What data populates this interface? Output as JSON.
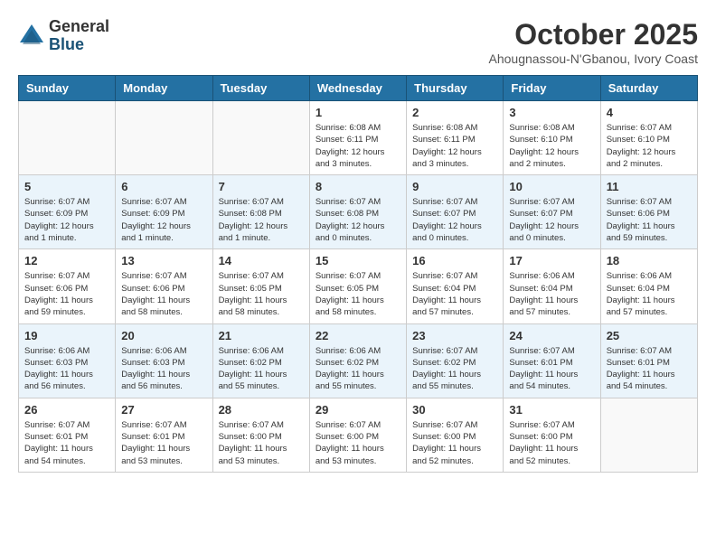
{
  "logo": {
    "general": "General",
    "blue": "Blue"
  },
  "header": {
    "month": "October 2025",
    "location": "Ahougnassou-N'Gbanou, Ivory Coast"
  },
  "weekdays": [
    "Sunday",
    "Monday",
    "Tuesday",
    "Wednesday",
    "Thursday",
    "Friday",
    "Saturday"
  ],
  "weeks": [
    [
      {
        "day": "",
        "info": ""
      },
      {
        "day": "",
        "info": ""
      },
      {
        "day": "",
        "info": ""
      },
      {
        "day": "1",
        "info": "Sunrise: 6:08 AM\nSunset: 6:11 PM\nDaylight: 12 hours and 3 minutes."
      },
      {
        "day": "2",
        "info": "Sunrise: 6:08 AM\nSunset: 6:11 PM\nDaylight: 12 hours and 3 minutes."
      },
      {
        "day": "3",
        "info": "Sunrise: 6:08 AM\nSunset: 6:10 PM\nDaylight: 12 hours and 2 minutes."
      },
      {
        "day": "4",
        "info": "Sunrise: 6:07 AM\nSunset: 6:10 PM\nDaylight: 12 hours and 2 minutes."
      }
    ],
    [
      {
        "day": "5",
        "info": "Sunrise: 6:07 AM\nSunset: 6:09 PM\nDaylight: 12 hours and 1 minute."
      },
      {
        "day": "6",
        "info": "Sunrise: 6:07 AM\nSunset: 6:09 PM\nDaylight: 12 hours and 1 minute."
      },
      {
        "day": "7",
        "info": "Sunrise: 6:07 AM\nSunset: 6:08 PM\nDaylight: 12 hours and 1 minute."
      },
      {
        "day": "8",
        "info": "Sunrise: 6:07 AM\nSunset: 6:08 PM\nDaylight: 12 hours and 0 minutes."
      },
      {
        "day": "9",
        "info": "Sunrise: 6:07 AM\nSunset: 6:07 PM\nDaylight: 12 hours and 0 minutes."
      },
      {
        "day": "10",
        "info": "Sunrise: 6:07 AM\nSunset: 6:07 PM\nDaylight: 12 hours and 0 minutes."
      },
      {
        "day": "11",
        "info": "Sunrise: 6:07 AM\nSunset: 6:06 PM\nDaylight: 11 hours and 59 minutes."
      }
    ],
    [
      {
        "day": "12",
        "info": "Sunrise: 6:07 AM\nSunset: 6:06 PM\nDaylight: 11 hours and 59 minutes."
      },
      {
        "day": "13",
        "info": "Sunrise: 6:07 AM\nSunset: 6:06 PM\nDaylight: 11 hours and 58 minutes."
      },
      {
        "day": "14",
        "info": "Sunrise: 6:07 AM\nSunset: 6:05 PM\nDaylight: 11 hours and 58 minutes."
      },
      {
        "day": "15",
        "info": "Sunrise: 6:07 AM\nSunset: 6:05 PM\nDaylight: 11 hours and 58 minutes."
      },
      {
        "day": "16",
        "info": "Sunrise: 6:07 AM\nSunset: 6:04 PM\nDaylight: 11 hours and 57 minutes."
      },
      {
        "day": "17",
        "info": "Sunrise: 6:06 AM\nSunset: 6:04 PM\nDaylight: 11 hours and 57 minutes."
      },
      {
        "day": "18",
        "info": "Sunrise: 6:06 AM\nSunset: 6:04 PM\nDaylight: 11 hours and 57 minutes."
      }
    ],
    [
      {
        "day": "19",
        "info": "Sunrise: 6:06 AM\nSunset: 6:03 PM\nDaylight: 11 hours and 56 minutes."
      },
      {
        "day": "20",
        "info": "Sunrise: 6:06 AM\nSunset: 6:03 PM\nDaylight: 11 hours and 56 minutes."
      },
      {
        "day": "21",
        "info": "Sunrise: 6:06 AM\nSunset: 6:02 PM\nDaylight: 11 hours and 55 minutes."
      },
      {
        "day": "22",
        "info": "Sunrise: 6:06 AM\nSunset: 6:02 PM\nDaylight: 11 hours and 55 minutes."
      },
      {
        "day": "23",
        "info": "Sunrise: 6:07 AM\nSunset: 6:02 PM\nDaylight: 11 hours and 55 minutes."
      },
      {
        "day": "24",
        "info": "Sunrise: 6:07 AM\nSunset: 6:01 PM\nDaylight: 11 hours and 54 minutes."
      },
      {
        "day": "25",
        "info": "Sunrise: 6:07 AM\nSunset: 6:01 PM\nDaylight: 11 hours and 54 minutes."
      }
    ],
    [
      {
        "day": "26",
        "info": "Sunrise: 6:07 AM\nSunset: 6:01 PM\nDaylight: 11 hours and 54 minutes."
      },
      {
        "day": "27",
        "info": "Sunrise: 6:07 AM\nSunset: 6:01 PM\nDaylight: 11 hours and 53 minutes."
      },
      {
        "day": "28",
        "info": "Sunrise: 6:07 AM\nSunset: 6:00 PM\nDaylight: 11 hours and 53 minutes."
      },
      {
        "day": "29",
        "info": "Sunrise: 6:07 AM\nSunset: 6:00 PM\nDaylight: 11 hours and 53 minutes."
      },
      {
        "day": "30",
        "info": "Sunrise: 6:07 AM\nSunset: 6:00 PM\nDaylight: 11 hours and 52 minutes."
      },
      {
        "day": "31",
        "info": "Sunrise: 6:07 AM\nSunset: 6:00 PM\nDaylight: 11 hours and 52 minutes."
      },
      {
        "day": "",
        "info": ""
      }
    ]
  ]
}
